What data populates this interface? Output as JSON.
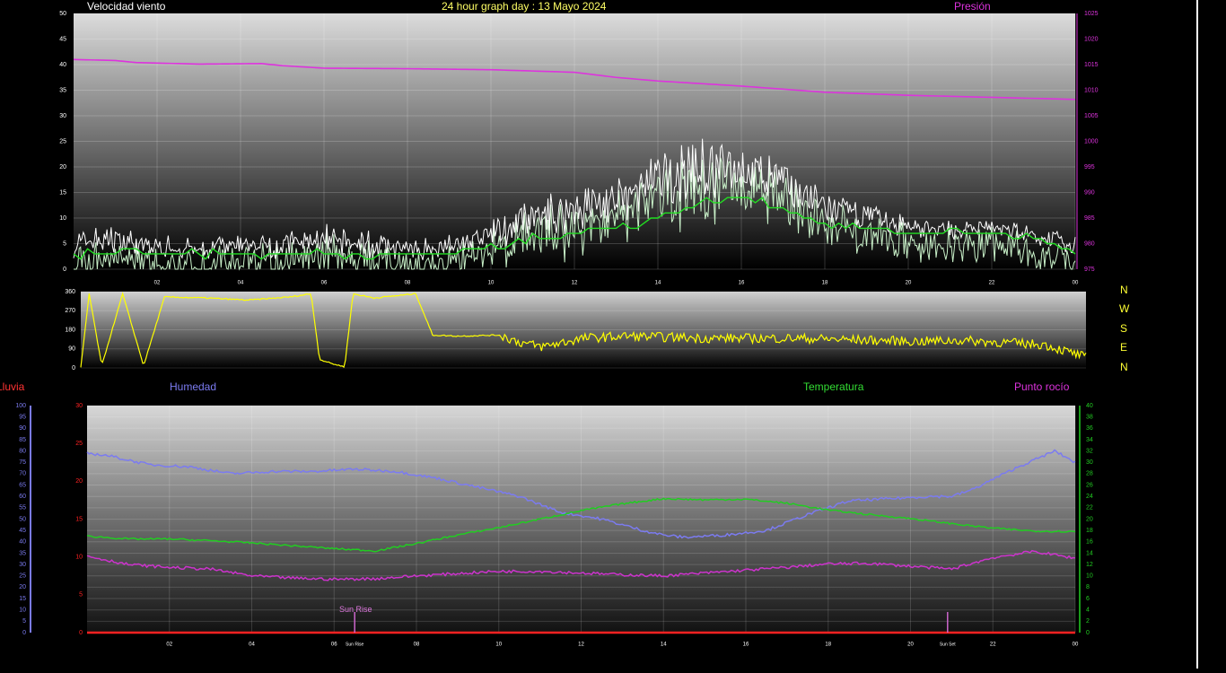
{
  "header": {
    "wind_title": "Velocidad viento",
    "date_title": "24 hour graph day : 13 Mayo 2024",
    "pressure_title": "Presión"
  },
  "direction_labels": [
    "N",
    "W",
    "S",
    "E",
    "N"
  ],
  "lower_header": {
    "rain_title": "Lluvia",
    "humidity_title": "Humedad",
    "temperature_title": "Temperatura",
    "dewpoint_title": "Punto rocío"
  },
  "colors": {
    "wind_gust": "#ffffff",
    "wind_speed": "#c8f0c8",
    "wind_avg": "#22dd22",
    "pressure": "#dd33dd",
    "direction": "#ffff00",
    "humidity": "#7b7bf0",
    "temperature": "#22cc22",
    "dewpoint": "#cc33cc",
    "rain": "#ff2222",
    "sun_marker": "#cc66cc"
  },
  "chart_data": [
    {
      "type": "line",
      "name": "wind-pressure",
      "x_ticks": [
        "02",
        "04",
        "06",
        "08",
        "10",
        "12",
        "14",
        "16",
        "18",
        "20",
        "22",
        "00"
      ],
      "y_left_ticks": [
        "0",
        "5",
        "10",
        "15",
        "20",
        "25",
        "30",
        "35",
        "40",
        "45",
        "50"
      ],
      "y_left_range": [
        0,
        50
      ],
      "y_right_ticks": [
        "975",
        "980",
        "985",
        "990",
        "995",
        "1000",
        "1005",
        "1010",
        "1015",
        "1020",
        "1025"
      ],
      "y_right_range": [
        975,
        1025
      ],
      "x_range_hours": [
        0,
        24
      ],
      "series": [
        {
          "key": "pressure",
          "axis": "right",
          "x": [
            0,
            1,
            1.5,
            3,
            4.5,
            5,
            6,
            8,
            10,
            12,
            13,
            14,
            16,
            17,
            18,
            20,
            22,
            24
          ],
          "values": [
            1016,
            1015.8,
            1015.4,
            1015.1,
            1015.2,
            1014.8,
            1014.3,
            1014.2,
            1014.0,
            1013.5,
            1012.5,
            1011.8,
            1010.8,
            1010.2,
            1009.6,
            1009.0,
            1008.6,
            1008.2
          ]
        },
        {
          "key": "wind_avg",
          "axis": "left",
          "x": [
            0,
            1,
            2,
            3,
            4,
            5,
            6,
            7,
            8,
            9,
            10,
            11,
            12,
            13,
            14,
            15,
            16,
            17,
            18,
            19,
            20,
            21,
            22,
            23,
            24
          ],
          "values": [
            3,
            4,
            3,
            3,
            3,
            3,
            3,
            3,
            3,
            3,
            4,
            6,
            7,
            8,
            10,
            13,
            14,
            12,
            9,
            8,
            7,
            7,
            7,
            6,
            3
          ]
        },
        {
          "key": "wind_gust_envelope",
          "axis": "left",
          "x": [
            0,
            1,
            2,
            3,
            4,
            5,
            6,
            7,
            8,
            9,
            10,
            11,
            12,
            13,
            14,
            15,
            16,
            17,
            18,
            19,
            20,
            21,
            22,
            23,
            24
          ],
          "values": [
            8,
            9,
            7,
            6,
            7,
            8,
            9,
            8,
            6,
            7,
            10,
            14,
            17,
            18,
            23,
            26,
            25,
            22,
            16,
            13,
            11,
            10,
            10,
            9,
            7
          ]
        }
      ]
    },
    {
      "type": "line",
      "name": "wind-direction",
      "y_ticks": [
        "0",
        "90",
        "180",
        "270",
        "360"
      ],
      "y_range": [
        0,
        360
      ],
      "x_range_hours": [
        0,
        24
      ],
      "series": [
        {
          "key": "direction",
          "x": [
            0,
            0.2,
            0.5,
            1,
            1.5,
            2,
            3,
            4,
            5,
            5.5,
            5.7,
            6,
            6.3,
            6.5,
            7,
            8,
            8.4,
            9,
            10,
            10.5,
            11,
            12,
            13,
            14,
            15,
            16,
            17,
            18,
            19,
            20,
            21,
            22,
            23,
            24
          ],
          "values": [
            0,
            350,
            10,
            350,
            10,
            335,
            330,
            320,
            335,
            350,
            40,
            20,
            5,
            350,
            330,
            350,
            155,
            150,
            155,
            120,
            100,
            140,
            150,
            145,
            140,
            140,
            140,
            135,
            130,
            125,
            130,
            120,
            110,
            50
          ]
        }
      ]
    },
    {
      "type": "line",
      "name": "temp-humidity-dew",
      "x_ticks": [
        "02",
        "04",
        "06",
        "08",
        "10",
        "12",
        "14",
        "16",
        "18",
        "20",
        "22",
        "00"
      ],
      "sun_rise_label": "Sun Rise",
      "sun_set_label": "Sun Set",
      "sun_rise_hour": 6.5,
      "sun_set_hour": 20.9,
      "humidity_ticks": [
        "0",
        "5",
        "10",
        "15",
        "20",
        "25",
        "30",
        "35",
        "40",
        "45",
        "50",
        "55",
        "60",
        "65",
        "70",
        "75",
        "80",
        "85",
        "90",
        "95",
        "100"
      ],
      "humidity_range": [
        0,
        100
      ],
      "rain_ticks": [
        "0",
        "5",
        "10",
        "15",
        "20",
        "25",
        "30"
      ],
      "rain_range": [
        0,
        30
      ],
      "temp_ticks": [
        "0",
        "2",
        "4",
        "6",
        "8",
        "10",
        "12",
        "14",
        "16",
        "18",
        "20",
        "22",
        "24",
        "26",
        "28",
        "30",
        "32",
        "34",
        "36",
        "38",
        "40"
      ],
      "temp_range": [
        0,
        40
      ],
      "series": [
        {
          "key": "humidity",
          "axis": "humidity",
          "x": [
            0,
            0.5,
            1.5,
            2.5,
            3.5,
            4.5,
            5.5,
            6.5,
            7.5,
            8.5,
            9.5,
            10.5,
            11.5,
            12.5,
            13.5,
            14,
            14.5,
            15.5,
            16.5,
            17.5,
            18.5,
            19.5,
            20.5,
            21,
            21.5,
            22.5,
            23.5,
            24
          ],
          "values": [
            79,
            78,
            74,
            73,
            70,
            71,
            71,
            72,
            71,
            68,
            64,
            60,
            53,
            50,
            45,
            43,
            42,
            43,
            45,
            52,
            58,
            59,
            60,
            60,
            63,
            72,
            80,
            75
          ]
        },
        {
          "key": "temperature",
          "axis": "temp",
          "x": [
            0,
            1,
            2,
            3,
            4,
            5,
            6,
            7,
            8,
            9,
            10,
            11,
            12,
            13,
            14,
            15,
            16,
            17,
            18,
            19,
            20,
            21,
            22,
            23,
            24
          ],
          "values": [
            17,
            16.5,
            16.5,
            16.2,
            15.8,
            15.3,
            14.8,
            14.4,
            15.7,
            17.2,
            18.5,
            20,
            21.5,
            22.7,
            23.6,
            23.4,
            23.5,
            22.8,
            21.6,
            20.8,
            20.1,
            19.2,
            18.4,
            17.9,
            17.8
          ]
        },
        {
          "key": "dewpoint",
          "axis": "temp",
          "x": [
            0,
            1,
            2,
            3,
            4,
            5,
            6,
            7,
            8,
            9,
            10,
            11,
            12,
            13,
            14,
            15,
            16,
            17,
            18,
            19,
            20,
            21,
            22,
            23,
            24
          ],
          "values": [
            13.5,
            12,
            11.5,
            11.2,
            10,
            9.6,
            9.4,
            9.5,
            10,
            10.4,
            10.8,
            10.8,
            10.5,
            10.2,
            10,
            10.5,
            11,
            11.5,
            12.1,
            12.2,
            11.7,
            11.2,
            13.2,
            14.3,
            13.1
          ]
        },
        {
          "key": "rain",
          "axis": "rain",
          "x": [
            0,
            24
          ],
          "values": [
            0,
            0
          ]
        }
      ]
    }
  ]
}
